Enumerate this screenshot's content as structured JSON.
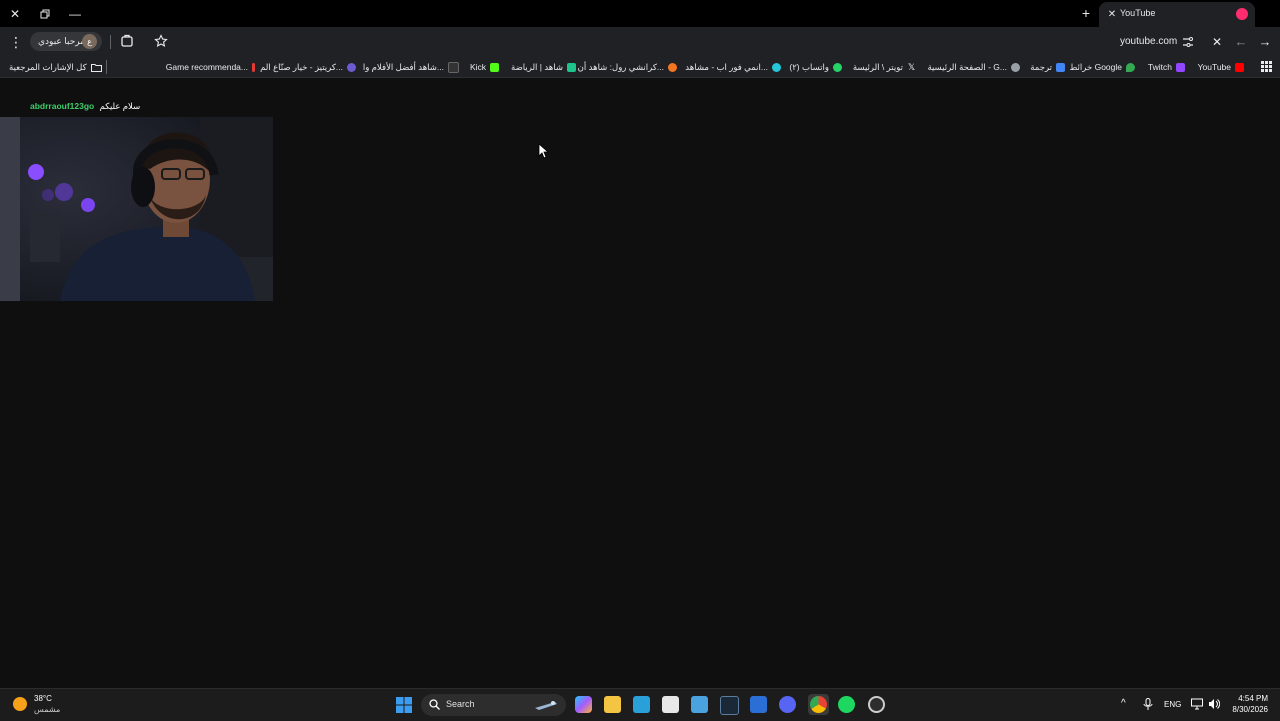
{
  "tab": {
    "title": "YouTube"
  },
  "toolbar": {
    "profile_name": "مرحبا عبودي",
    "profile_initial": "ع",
    "url": "youtube.com"
  },
  "bookmarks": [
    {
      "label": "YouTube",
      "icon": "youtube-icon",
      "color": "#ff0000"
    },
    {
      "label": "Twitch",
      "icon": "twitch-icon",
      "color": "#9146ff"
    },
    {
      "label": "خرائط Google",
      "icon": "maps-icon",
      "color": "#34a853"
    },
    {
      "label": "ترجمة",
      "icon": "translate-icon",
      "color": "#4285f4"
    },
    {
      "label": "الصفحة الرئيسية - G...",
      "icon": "site-icon",
      "color": "#9aa0a6"
    },
    {
      "label": "تويتر \\ الرئيسة",
      "icon": "x-icon",
      "color": "#ffffff"
    },
    {
      "label": "(٢) واتساب",
      "icon": "whatsapp-icon",
      "color": "#25d366"
    },
    {
      "label": "انمي فور اب - مشاهد...",
      "icon": "anime-icon",
      "color": "#26c6da"
    },
    {
      "label": "كرانشي رول: شاهد أن...",
      "icon": "crunchyroll-icon",
      "color": "#f47521"
    },
    {
      "label": "شاهد | الرياضة",
      "icon": "shahid-icon",
      "color": "#1ec28b"
    },
    {
      "label": "Kick",
      "icon": "kick-icon",
      "color": "#53fc18"
    },
    {
      "label": "شاهد أفضل الأفلام وا...",
      "icon": "movies-icon",
      "color": "#333333"
    },
    {
      "label": "كريتيز - خيار صنّاع الم...",
      "icon": "creators-icon",
      "color": "#6b5bd2"
    },
    {
      "label": "Game recommenda...",
      "icon": "game-icon",
      "color": "#e53935"
    },
    {
      "label": "كل الإشارات المرجعية",
      "icon": "folder-icon",
      "color": "#e8eaed"
    }
  ],
  "chat": {
    "username": "abdrraouf123go",
    "message": "سلام عليكم"
  },
  "taskbar": {
    "weather_temp": "38°C",
    "weather_desc": "مشمس",
    "search_label": "Search",
    "language": "ENG",
    "time": "4:54 PM",
    "date": "8/30/2026"
  },
  "colors": {
    "page_bg": "#0f0f0f",
    "chrome_bg": "#202124",
    "chat_username": "#3ecf6a"
  }
}
